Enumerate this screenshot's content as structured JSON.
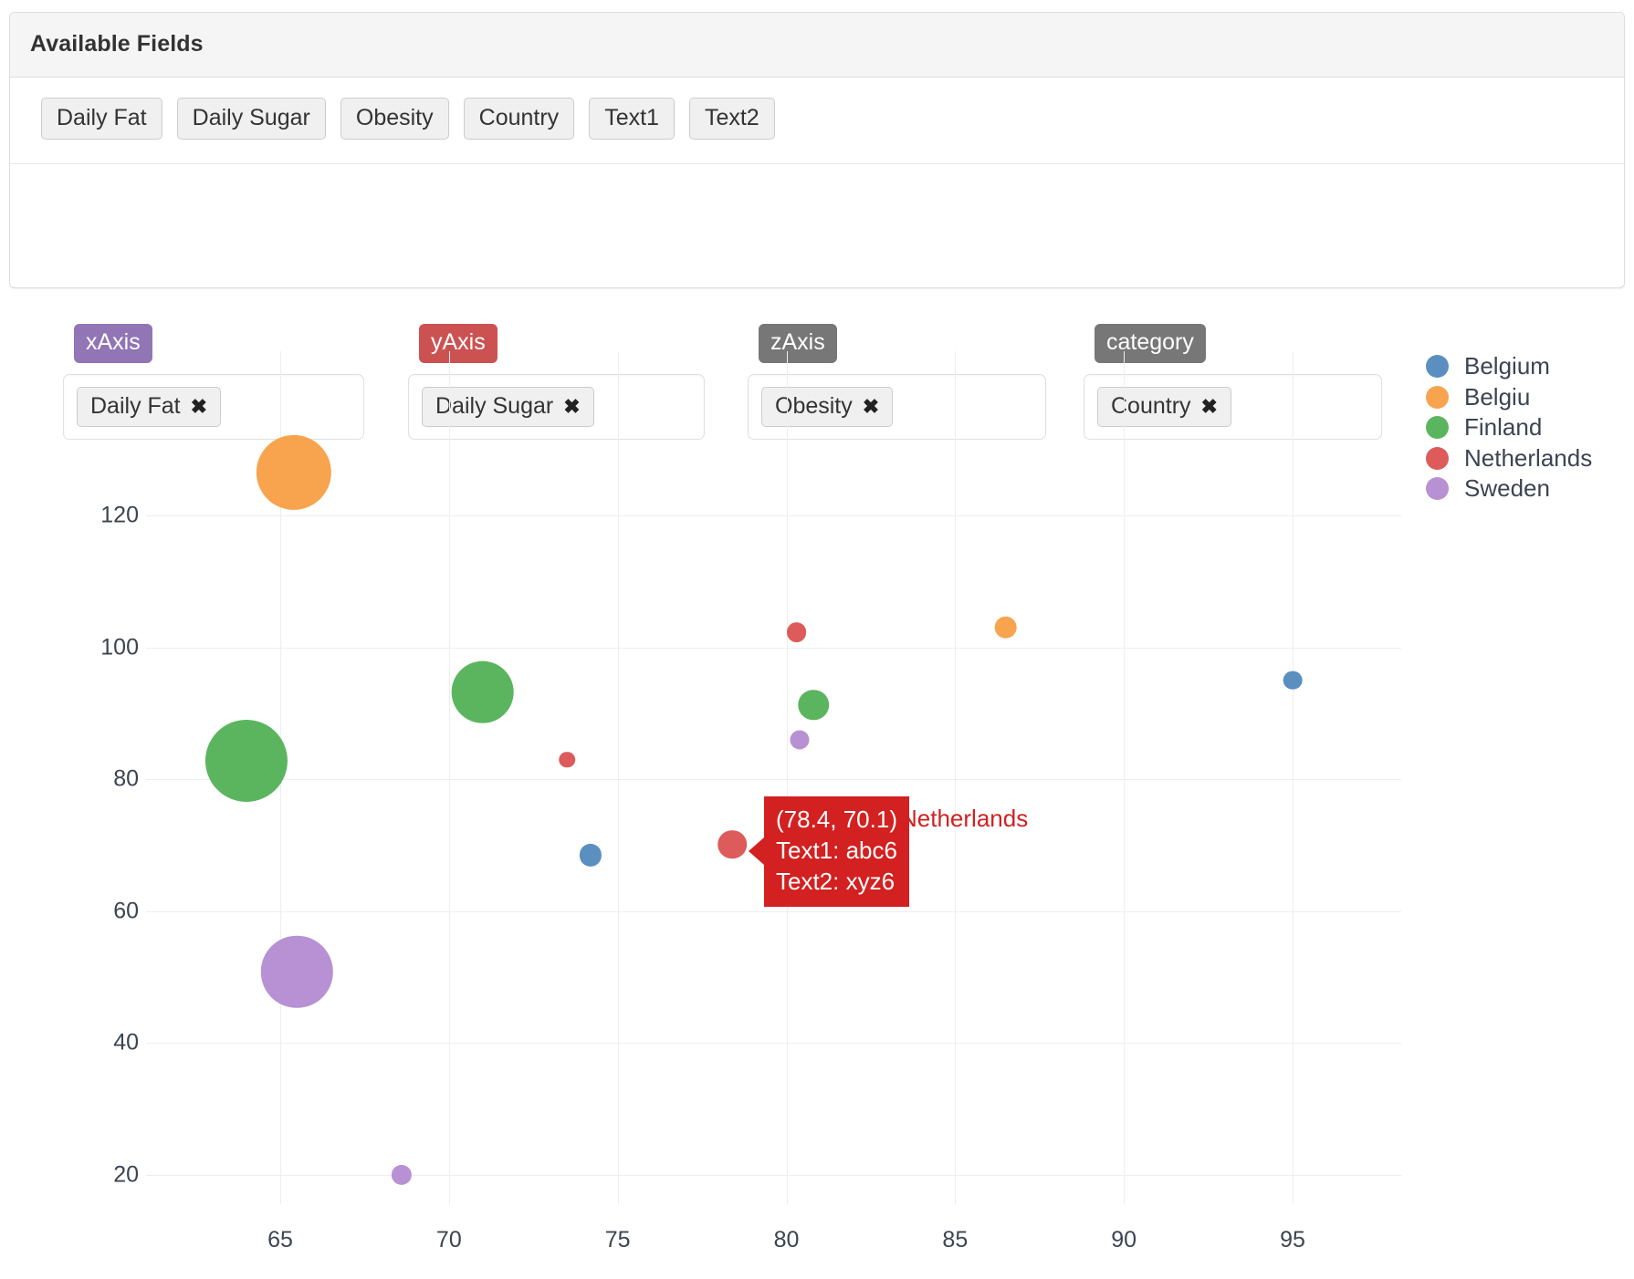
{
  "panel": {
    "title": "Available Fields",
    "available_fields": [
      "Daily Fat",
      "Daily Sugar",
      "Obesity",
      "Country",
      "Text1",
      "Text2"
    ],
    "zones": [
      {
        "badge": "xAxis",
        "badge_color": "#9175b5",
        "chip": "Daily Fat",
        "remove": "✖"
      },
      {
        "badge": "yAxis",
        "badge_color": "#cc5252",
        "chip": "Daily Sugar",
        "remove": "✖"
      },
      {
        "badge": "zAxis",
        "badge_color": "#777777",
        "chip": "Obesity",
        "remove": "✖"
      },
      {
        "badge": "category",
        "badge_color": "#777777",
        "chip": "Country",
        "remove": "✖"
      }
    ]
  },
  "tooltip": {
    "coords": "(78.4, 70.1)",
    "line1": "Text1: abc6",
    "line2": "Text2: xyz6",
    "category": "Netherlands",
    "color": "#d32020"
  },
  "chart_data": {
    "type": "scatter",
    "title": "",
    "xlabel": "Daily Fat",
    "ylabel": "Daily Sugar",
    "zlabel": "Obesity",
    "categorylabel": "Country",
    "grid": true,
    "legend_position": "right",
    "xlim": [
      62.0,
      97.0
    ],
    "ylim": [
      12.0,
      133.0
    ],
    "xticks": [
      65,
      70,
      75,
      80,
      85,
      90,
      95
    ],
    "yticks": [
      20,
      40,
      60,
      80,
      100,
      120
    ],
    "legend": [
      {
        "name": "Belgium",
        "color": "#5b8fc0"
      },
      {
        "name": "Belgiu",
        "color": "#f8a34e"
      },
      {
        "name": "Finland",
        "color": "#5bb55f"
      },
      {
        "name": "Netherlands",
        "color": "#dd5b5b"
      },
      {
        "name": "Sweden",
        "color": "#b791d3"
      }
    ],
    "series": [
      {
        "name": "Belgium",
        "color": "#5b8fc0",
        "points": [
          {
            "x": 95.0,
            "y": 95.0,
            "z": 6.2
          },
          {
            "x": 74.2,
            "y": 68.5,
            "z": 7.1
          }
        ]
      },
      {
        "name": "Belgiu",
        "color": "#f8a34e",
        "points": [
          {
            "x": 65.4,
            "y": 126.5,
            "z": 22.0
          },
          {
            "x": 86.5,
            "y": 103.0,
            "z": 7.2
          }
        ]
      },
      {
        "name": "Finland",
        "color": "#5bb55f",
        "points": [
          {
            "x": 64.0,
            "y": 82.8,
            "z": 24.0
          },
          {
            "x": 71.0,
            "y": 93.2,
            "z": 18.5
          },
          {
            "x": 80.8,
            "y": 91.3,
            "z": 9.5
          }
        ]
      },
      {
        "name": "Netherlands",
        "color": "#dd5b5b",
        "points": [
          {
            "x": 80.3,
            "y": 102.3,
            "z": 6.5
          },
          {
            "x": 73.5,
            "y": 83.0,
            "z": 5.4
          },
          {
            "x": 78.4,
            "y": 70.1,
            "z": 9.0
          }
        ]
      },
      {
        "name": "Sweden",
        "color": "#b791d3",
        "points": [
          {
            "x": 65.5,
            "y": 50.8,
            "z": 21.0
          },
          {
            "x": 80.4,
            "y": 86.0,
            "z": 6.3
          },
          {
            "x": 68.6,
            "y": 20.0,
            "z": 6.6
          }
        ]
      }
    ]
  }
}
